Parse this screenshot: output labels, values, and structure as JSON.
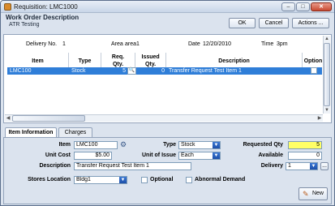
{
  "window": {
    "title": "Requisition: LMC1000"
  },
  "header": {
    "title": "Work Order Description",
    "subtitle": "ATR Testing"
  },
  "buttons": {
    "ok": "OK",
    "cancel": "Cancel",
    "actions": "Actions ..."
  },
  "meta": {
    "delivery_label": "Delivery No.",
    "delivery_value": "1",
    "area_label": "Area",
    "area_value": "area1",
    "date_label": "Date",
    "date_value": "12/20/2010",
    "time_label": "Time",
    "time_value": "3pm"
  },
  "grid": {
    "columns": [
      "Item",
      "Type",
      "Req. Qty.",
      "Issued Qty.",
      "Description",
      "Option"
    ],
    "rows": [
      {
        "item": "LMC100",
        "type": "Stock",
        "req_qty": "5",
        "issued_qty": "0",
        "description": "Transfer Request Test Item 1"
      }
    ]
  },
  "tabs": [
    "Item Information",
    "Charges"
  ],
  "form": {
    "item_label": "Item",
    "item_value": "LMC100",
    "unit_cost_label": "Unit Cost",
    "unit_cost_value": "$5.00",
    "description_label": "Description",
    "description_value": "Transfer Request Test Item 1",
    "stores_location_label": "Stores Location",
    "stores_location_value": "Bldg1",
    "type_label": "Type",
    "type_value": "Stock",
    "unit_of_issue_label": "Unit of Issue",
    "unit_of_issue_value": "Each",
    "requested_qty_label": "Requested Qty",
    "requested_qty_value": "5",
    "available_label": "Available",
    "available_value": "0",
    "delivery_label": "Delivery",
    "delivery_value": "1",
    "optional_label": "Optional",
    "abnormal_demand_label": "Abnormal Demand",
    "new_button": "New"
  },
  "colors": {
    "selection": "#2f7ed8",
    "highlight": "#ffff66"
  }
}
